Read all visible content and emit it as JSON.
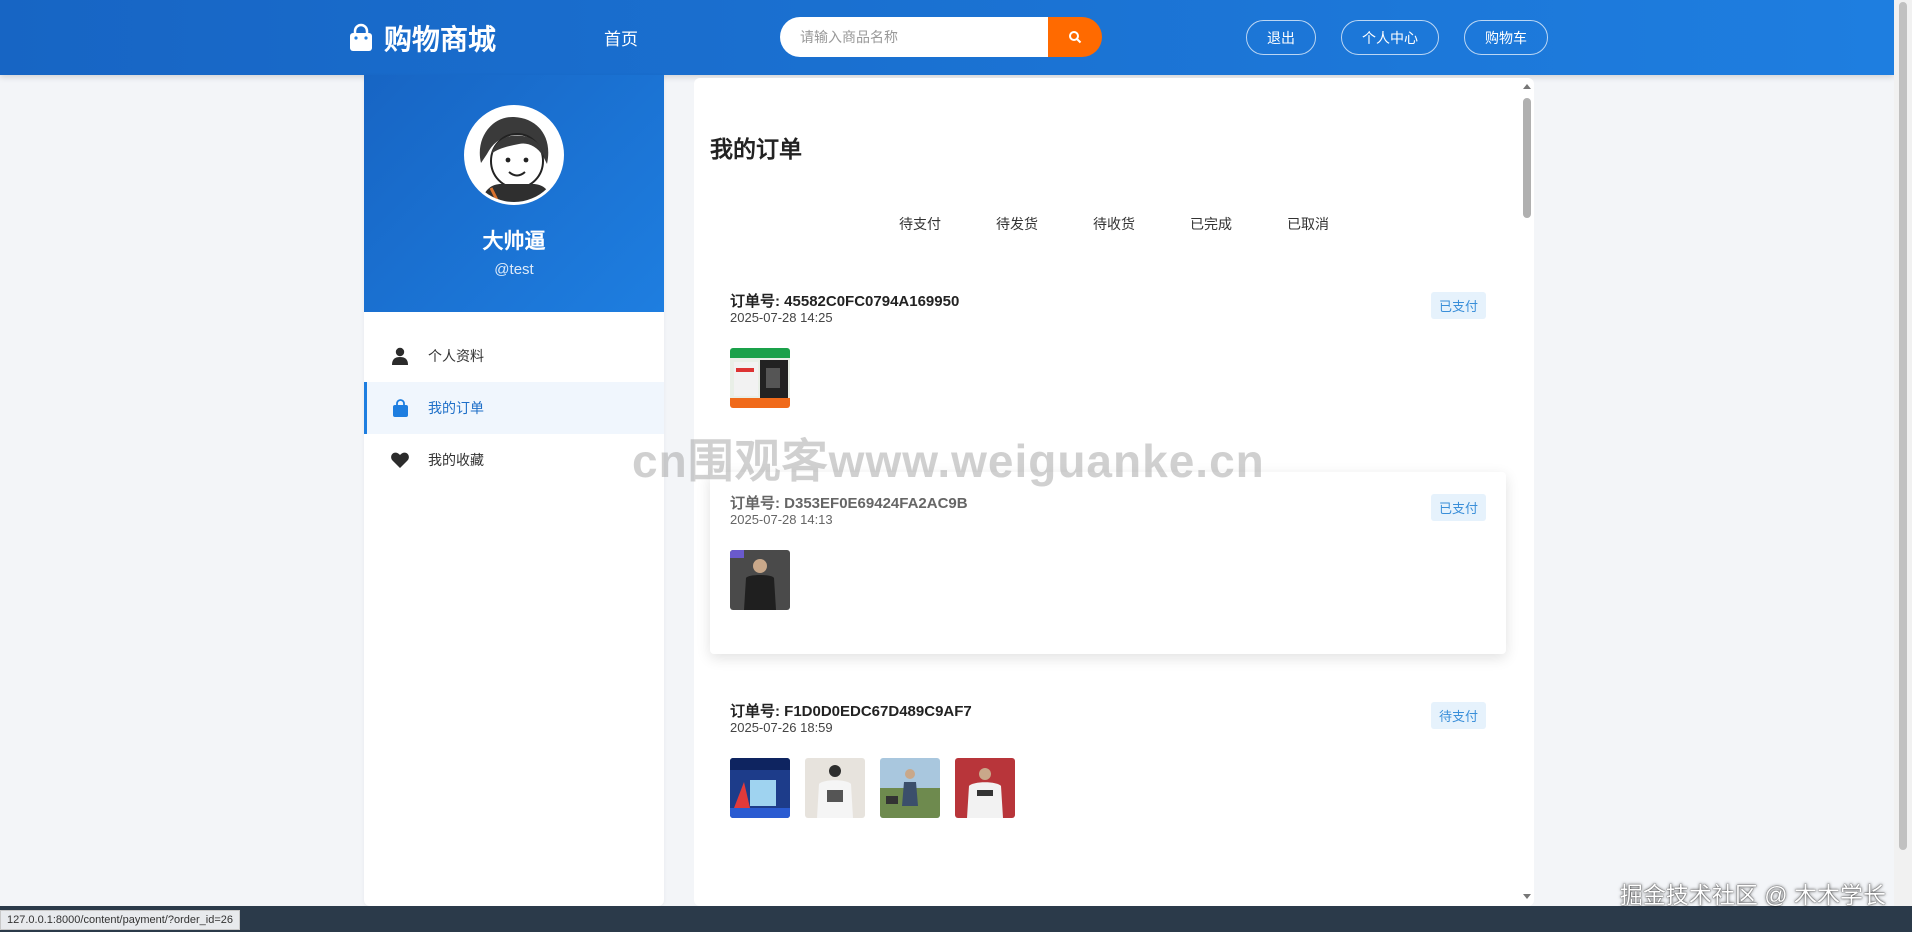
{
  "header": {
    "logo_text": "购物商城",
    "nav_home": "首页",
    "search_placeholder": "请输入商品名称",
    "buttons": {
      "logout": "退出",
      "profile_center": "个人中心",
      "cart": "购物车"
    }
  },
  "sidebar": {
    "user_name": "大帅逼",
    "user_handle": "@test",
    "menu": [
      {
        "label": "个人资料",
        "icon": "user-icon"
      },
      {
        "label": "我的订单",
        "icon": "shopping-bag-icon"
      },
      {
        "label": "我的收藏",
        "icon": "heart-icon"
      }
    ]
  },
  "orders_page": {
    "title": "我的订单",
    "tabs": [
      "待支付",
      "待发货",
      "待收货",
      "已完成",
      "已取消"
    ],
    "orders": [
      {
        "order_no": "订单号: 45582C0FC0794A169950",
        "time": "2025-07-28 14:25",
        "status": "已支付",
        "thumb_count": 1
      },
      {
        "order_no": "订单号: D353EF0E69424FA2AC9B",
        "time": "2025-07-28 14:13",
        "status": "已支付",
        "thumb_count": 1
      },
      {
        "order_no": "订单号: F1D0D0EDC67D489C9AF7",
        "time": "2025-07-26 18:59",
        "status": "待支付",
        "thumb_count": 4
      }
    ]
  },
  "status_url": "127.0.0.1:8000/content/payment/?order_id=26",
  "watermarks": {
    "center": "cn围观客www.weiguanke.cn",
    "bottom": "掘金技术社区 @ 木木学长"
  },
  "colors": {
    "header_blue": "#1e7ee0",
    "search_orange": "#ff6a00",
    "badge_bg": "#e6f2fc"
  }
}
